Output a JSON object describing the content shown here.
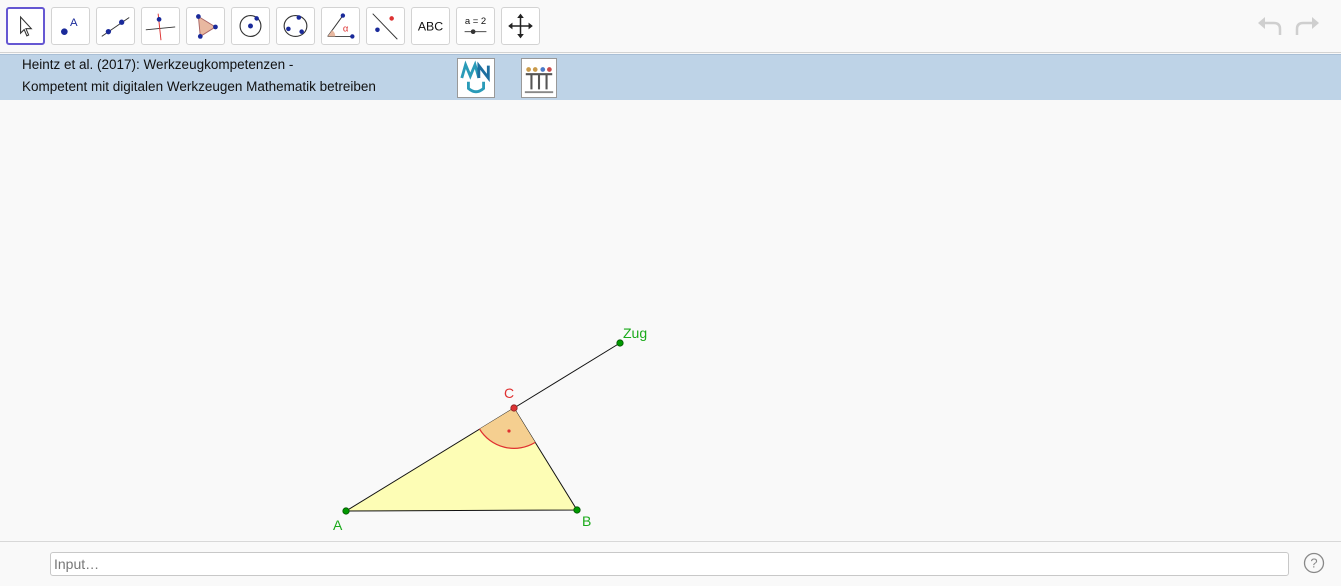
{
  "toolbar": {
    "tools": [
      {
        "name": "move",
        "icon": "arrow-cursor-icon"
      },
      {
        "name": "point",
        "icon": "point-icon",
        "label": "A"
      },
      {
        "name": "line",
        "icon": "line-icon"
      },
      {
        "name": "perpendicular",
        "icon": "perpendicular-line-icon"
      },
      {
        "name": "polygon",
        "icon": "polygon-icon"
      },
      {
        "name": "circle-center",
        "icon": "circle-center-point-icon"
      },
      {
        "name": "circle-three-points",
        "icon": "circle-three-points-icon"
      },
      {
        "name": "angle",
        "icon": "angle-icon",
        "label": "α"
      },
      {
        "name": "reflect",
        "icon": "reflect-point-icon"
      },
      {
        "name": "text",
        "icon": "text-icon",
        "label": "ABC"
      },
      {
        "name": "slider",
        "icon": "slider-icon",
        "label": "a = 2"
      },
      {
        "name": "move-graphics",
        "icon": "move-graphics-icon"
      }
    ],
    "undo": "undo-icon",
    "redo": "redo-icon"
  },
  "header": {
    "line1": "Heintz et al. (2017): Werkzeugkompetenzen -",
    "line2": "Kompetent mit digitalen Werkzeugen Mathematik betreiben",
    "logo1": "MNU",
    "logo2": "T³ DEUTSCHLAND"
  },
  "graphics": {
    "points": {
      "A": "A",
      "B": "B",
      "C": "C",
      "Zug": "Zug"
    },
    "colors": {
      "triangle_fill": "#ffff99",
      "angle_fill": "#f5cf90",
      "angle_stroke": "#e03030",
      "point_green": "#009900",
      "point_red": "#dd3333",
      "label_green": "#1aaa1a",
      "label_red": "#e03030"
    }
  },
  "input": {
    "placeholder": "Input…"
  },
  "help": "?"
}
